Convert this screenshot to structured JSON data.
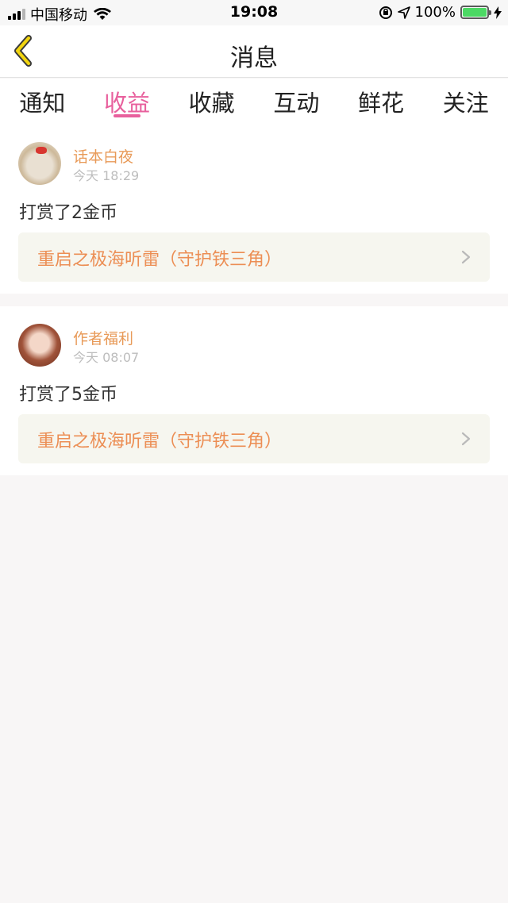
{
  "status_bar": {
    "carrier": "中国移动",
    "time": "19:08",
    "battery": "100%"
  },
  "nav": {
    "title": "消息"
  },
  "tabs": [
    {
      "label": "通知",
      "active": false
    },
    {
      "label": "收益",
      "active": true
    },
    {
      "label": "收藏",
      "active": false
    },
    {
      "label": "互动",
      "active": false
    },
    {
      "label": "鲜花",
      "active": false
    },
    {
      "label": "关注",
      "active": false
    }
  ],
  "items": [
    {
      "user": "话本白夜",
      "time": "今天 18:29",
      "message": "打赏了2金币",
      "book": "重启之极海听雷（守护铁三角）"
    },
    {
      "user": "作者福利",
      "time": "今天 08:07",
      "message": "打赏了5金币",
      "book": "重启之极海听雷（守护铁三角）"
    }
  ],
  "colors": {
    "accent_pink": "#e8609d",
    "username_orange": "#e89a58",
    "book_orange": "#ec8e54",
    "back_arrow_yellow": "#f2d50f"
  },
  "icons": {
    "back": "chevron-left-icon",
    "card_arrow": "chevron-right-icon"
  }
}
